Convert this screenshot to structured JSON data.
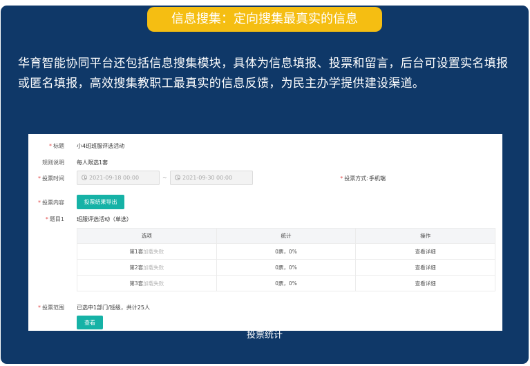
{
  "header": {
    "title": "信息搜集：定向搜集最真实的信息"
  },
  "intro": "华育智能协同平台还包括信息搜集模块，具体为信息填报、投票和留言，后台可设置实名填报或匿名填报，高效搜集教职工最真实的信息反馈，为民主办学提供建设渠道。",
  "form": {
    "title_label": "标题",
    "title_value": "小4班班服评选活动",
    "rule_label": "规则说明",
    "rule_value": "每人限选1套",
    "time_label": "投票时间",
    "start_time": "2021-09-18 00:00",
    "time_sep": "~",
    "end_time": "2021-09-30 00:00",
    "method_label": "投票方式:",
    "method_value": "手机端",
    "content_label": "投票内容",
    "export_button": "投票结果导出",
    "question_label": "题目1",
    "question_value": "班服评选活动（单选）",
    "table": {
      "headers": [
        "选项",
        "统计",
        "操作"
      ],
      "rows": [
        {
          "option": "第1套",
          "fail": "加载失败",
          "stat": "0票，0%",
          "action": "查看详细"
        },
        {
          "option": "第2套",
          "fail": "加载失败",
          "stat": "0票，0%",
          "action": "查看详细"
        },
        {
          "option": "第3套",
          "fail": "加载失败",
          "stat": "0票，0%",
          "action": "查看详细"
        }
      ]
    },
    "scope_label": "投票范围",
    "scope_value": "已选中1部门/班级，共计25人",
    "view_button": "查看"
  },
  "caption": "投票统计",
  "colors": {
    "panel": "#0f3868",
    "accent": "#f5be12",
    "teal": "#16b2a6"
  }
}
